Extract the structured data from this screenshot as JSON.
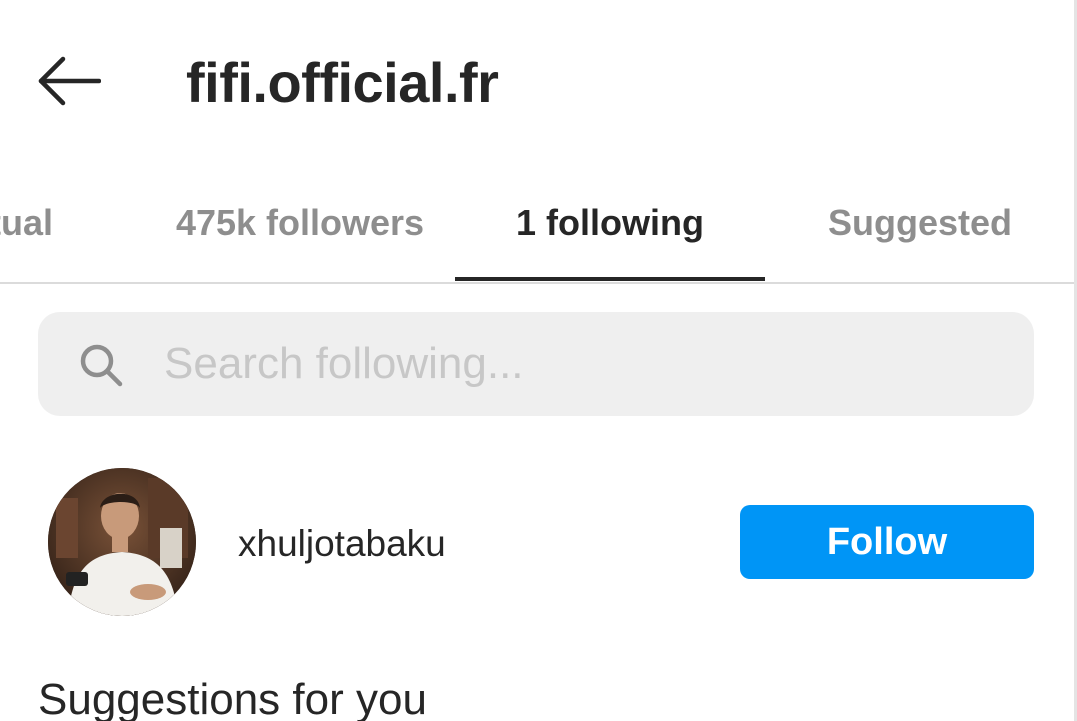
{
  "header": {
    "back_icon": "arrow-left-icon",
    "title": "fifi.official.fr"
  },
  "tabs": [
    {
      "label": "Mutual",
      "active": false
    },
    {
      "label": "475k followers",
      "active": false
    },
    {
      "label": "1 following",
      "active": true
    },
    {
      "label": "Suggested",
      "active": false
    }
  ],
  "search": {
    "icon": "search-icon",
    "placeholder": "Search following...",
    "value": ""
  },
  "following_list": [
    {
      "username": "xhuljotabaku",
      "follow_label": "Follow"
    }
  ],
  "suggestions": {
    "title": "Suggestions for you"
  },
  "colors": {
    "accent": "#0095f6",
    "text_primary": "#262626",
    "text_secondary": "#8e8e8e",
    "search_bg": "#efefef",
    "divider": "#dbdbdb"
  }
}
